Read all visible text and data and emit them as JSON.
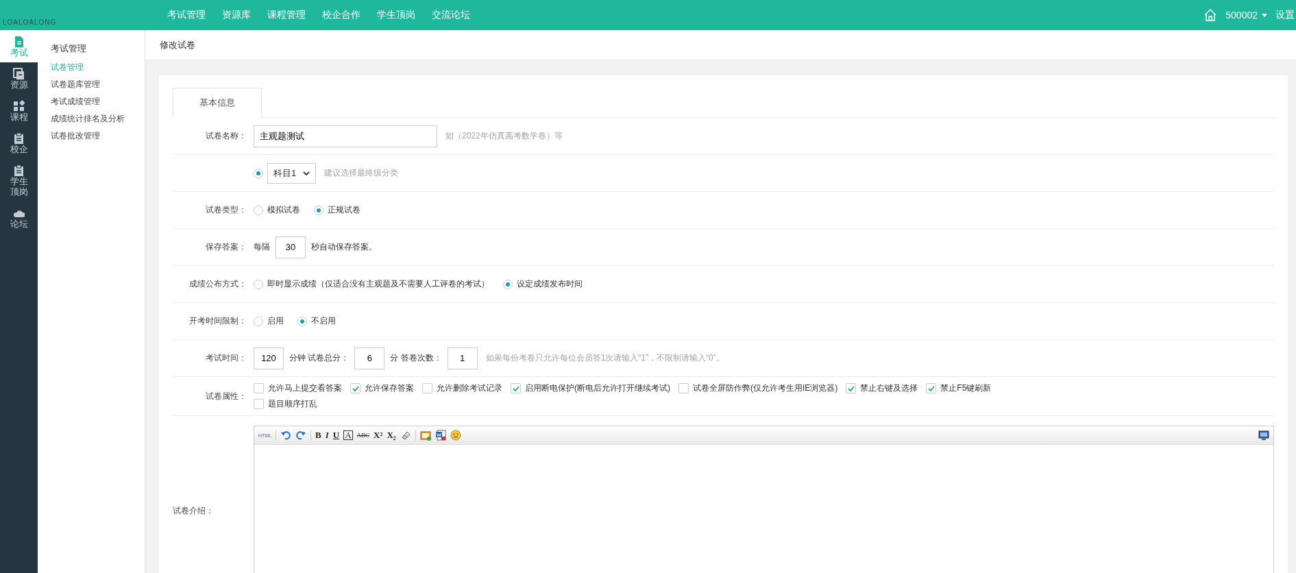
{
  "logo": {
    "text": "LOALOALONG"
  },
  "top_nav": [
    {
      "label": "考试管理"
    },
    {
      "label": "资源库"
    },
    {
      "label": "课程管理"
    },
    {
      "label": "校企合作"
    },
    {
      "label": "学生顶岗"
    },
    {
      "label": "交流论坛"
    }
  ],
  "user": {
    "name": "500002",
    "settings": "设置"
  },
  "sidebar": {
    "items": [
      {
        "label": "考试",
        "kind": "document",
        "selected": true
      },
      {
        "label": "资源",
        "kind": "copy",
        "selected": false
      },
      {
        "label": "课程",
        "kind": "grid",
        "selected": false
      },
      {
        "label": "校企",
        "kind": "clipboard",
        "selected": false
      },
      {
        "label": "学生顶岗",
        "kind": "clipboard",
        "selected": false
      },
      {
        "label": "论坛",
        "kind": "cloud",
        "selected": false
      }
    ]
  },
  "subnav": {
    "title": "考试管理",
    "items": [
      {
        "label": "试卷管理",
        "selected": true
      },
      {
        "label": "试卷题库管理",
        "selected": false
      },
      {
        "label": "考试成绩管理",
        "selected": false
      },
      {
        "label": "成绩统计排名及分析",
        "selected": false
      },
      {
        "label": "试卷批改管理",
        "selected": false
      }
    ]
  },
  "page_title": "修改试卷",
  "tabs": [
    {
      "label": "基本信息",
      "selected": true
    }
  ],
  "form": [
    {
      "kind": "text",
      "label": "试卷名称：",
      "value": "主观题测试",
      "hint": "如（2022年仿真高考数学卷）等"
    },
    {
      "kind": "select",
      "radio_checked": true,
      "value": "科目1",
      "hint": "建议选择最终级分类"
    },
    {
      "kind": "radio",
      "label": "试卷类型：",
      "options": [
        {
          "label": "模拟试卷",
          "selected": false
        },
        {
          "label": "正规试卷",
          "selected": true
        }
      ]
    },
    {
      "kind": "inline",
      "label": "保存答案：",
      "parts": [
        {
          "kind": "text",
          "text": "每隔"
        },
        {
          "kind": "input",
          "value": "30"
        },
        {
          "kind": "text",
          "text": "秒自动保存答案。"
        }
      ]
    },
    {
      "kind": "radio",
      "label": "成绩公布方式：",
      "options": [
        {
          "label": "即时显示成绩（仅适合没有主观题及不需要人工评卷的考试）",
          "selected": false
        },
        {
          "label": "设定成绩发布时间",
          "selected": true
        }
      ]
    },
    {
      "kind": "radio",
      "label": "开考时间限制：",
      "options": [
        {
          "label": "启用",
          "selected": false
        },
        {
          "label": "不启用",
          "selected": true
        }
      ]
    },
    {
      "kind": "inline",
      "label": "考试时间：",
      "parts": [
        {
          "kind": "input",
          "value": "120"
        },
        {
          "kind": "text",
          "text": "分钟 试卷总分："
        },
        {
          "kind": "input",
          "value": "6"
        },
        {
          "kind": "text",
          "text": "分 答卷次数："
        },
        {
          "kind": "input",
          "value": "1"
        },
        {
          "kind": "hint",
          "text": "如果每份考卷只允许每位会员答1次请输入“1”，不限制请输入“0”。"
        }
      ]
    },
    {
      "kind": "checkbox",
      "label": "试卷属性：",
      "options": [
        {
          "label": "允许马上提交看答案",
          "checked": false
        },
        {
          "label": "允许保存答案",
          "checked": true
        },
        {
          "label": "允许删除考试记录",
          "checked": false
        },
        {
          "label": "启用断电保护(断电后允许打开继续考试)",
          "checked": true
        },
        {
          "label": "试卷全屏防作弊(仅允许考生用IE浏览器)",
          "checked": false
        },
        {
          "label": "禁止右键及选择",
          "checked": true
        },
        {
          "label": "禁止F5键刷新",
          "checked": true
        },
        {
          "label": "题目顺序打乱",
          "checked": false
        }
      ]
    },
    {
      "kind": "editor",
      "label": "试卷介绍：",
      "toolbar": [
        {
          "kind": "html",
          "text": "HTML"
        },
        {
          "kind": "sep"
        },
        {
          "kind": "undo"
        },
        {
          "kind": "redo"
        },
        {
          "kind": "sep"
        },
        {
          "kind": "bold",
          "text": "B"
        },
        {
          "kind": "italic",
          "text": "I"
        },
        {
          "kind": "underline",
          "text": "U"
        },
        {
          "kind": "fontcolor",
          "text": "A"
        },
        {
          "kind": "strike",
          "text": "ABC"
        },
        {
          "kind": "sup",
          "text": "X²"
        },
        {
          "kind": "sub",
          "text": "X₂"
        },
        {
          "kind": "eraser"
        },
        {
          "kind": "sep"
        },
        {
          "kind": "image"
        },
        {
          "kind": "word"
        },
        {
          "kind": "emoji"
        }
      ],
      "right_tool": {
        "kind": "monitor"
      }
    }
  ]
}
